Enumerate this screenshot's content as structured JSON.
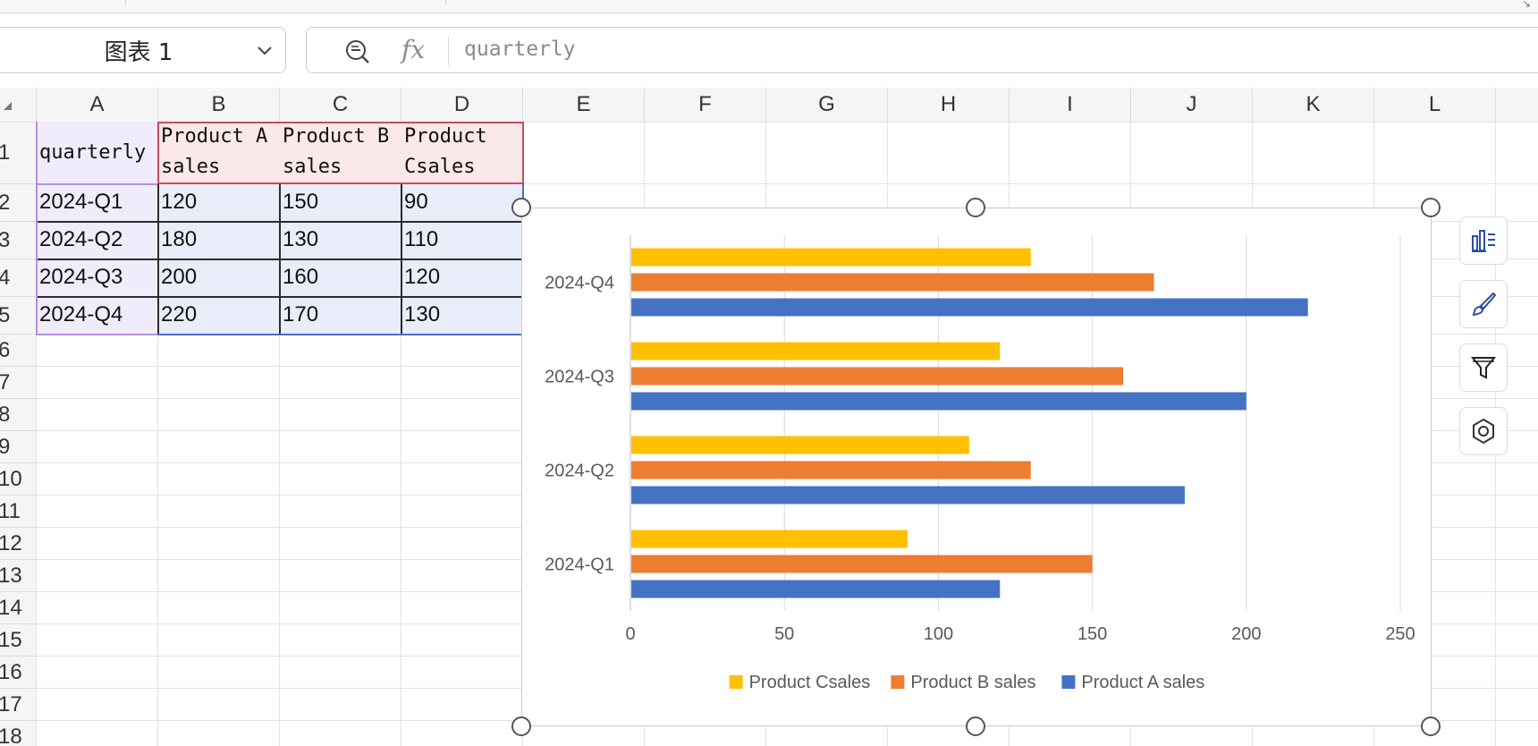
{
  "name_box": {
    "value": "图表 1"
  },
  "formula_bar": {
    "fx_label": "fx",
    "value": "quarterly"
  },
  "columns": [
    "A",
    "B",
    "C",
    "D",
    "E",
    "F",
    "G",
    "H",
    "I",
    "J",
    "K",
    "L"
  ],
  "rows": [
    "1",
    "2",
    "3",
    "4",
    "5",
    "6",
    "7",
    "8",
    "9",
    "10",
    "11",
    "12",
    "13",
    "14",
    "15",
    "16",
    "17",
    "18"
  ],
  "table": {
    "header": [
      "quarterly",
      "Product A sales",
      "Product B sales",
      "Product Csales"
    ],
    "rows": [
      [
        "2024-Q1",
        "120",
        "150",
        "90"
      ],
      [
        "2024-Q2",
        "180",
        "130",
        "110"
      ],
      [
        "2024-Q3",
        "200",
        "160",
        "120"
      ],
      [
        "2024-Q4",
        "220",
        "170",
        "130"
      ]
    ]
  },
  "colors": {
    "product_a": "#4472c4",
    "product_b": "#ed7d31",
    "product_c": "#ffc000"
  },
  "side_tools": [
    {
      "name": "chart-elements-icon"
    },
    {
      "name": "chart-style-icon"
    },
    {
      "name": "chart-filter-icon"
    },
    {
      "name": "chart-settings-icon"
    }
  ],
  "chart_data": {
    "type": "bar",
    "orientation": "horizontal",
    "categories": [
      "2024-Q1",
      "2024-Q2",
      "2024-Q3",
      "2024-Q4"
    ],
    "series": [
      {
        "name": "Product A sales",
        "values": [
          120,
          180,
          200,
          220
        ],
        "color": "#4472c4"
      },
      {
        "name": "Product B sales",
        "values": [
          150,
          130,
          160,
          170
        ],
        "color": "#ed7d31"
      },
      {
        "name": "Product Csales",
        "values": [
          90,
          110,
          120,
          130
        ],
        "color": "#ffc000"
      }
    ],
    "xlim": [
      0,
      250
    ],
    "xticks": [
      "0",
      "50",
      "100",
      "150",
      "200",
      "250"
    ],
    "grid": true,
    "legend": {
      "position": "bottom",
      "entries": [
        "Product Csales",
        "Product B sales",
        "Product A sales"
      ]
    }
  }
}
